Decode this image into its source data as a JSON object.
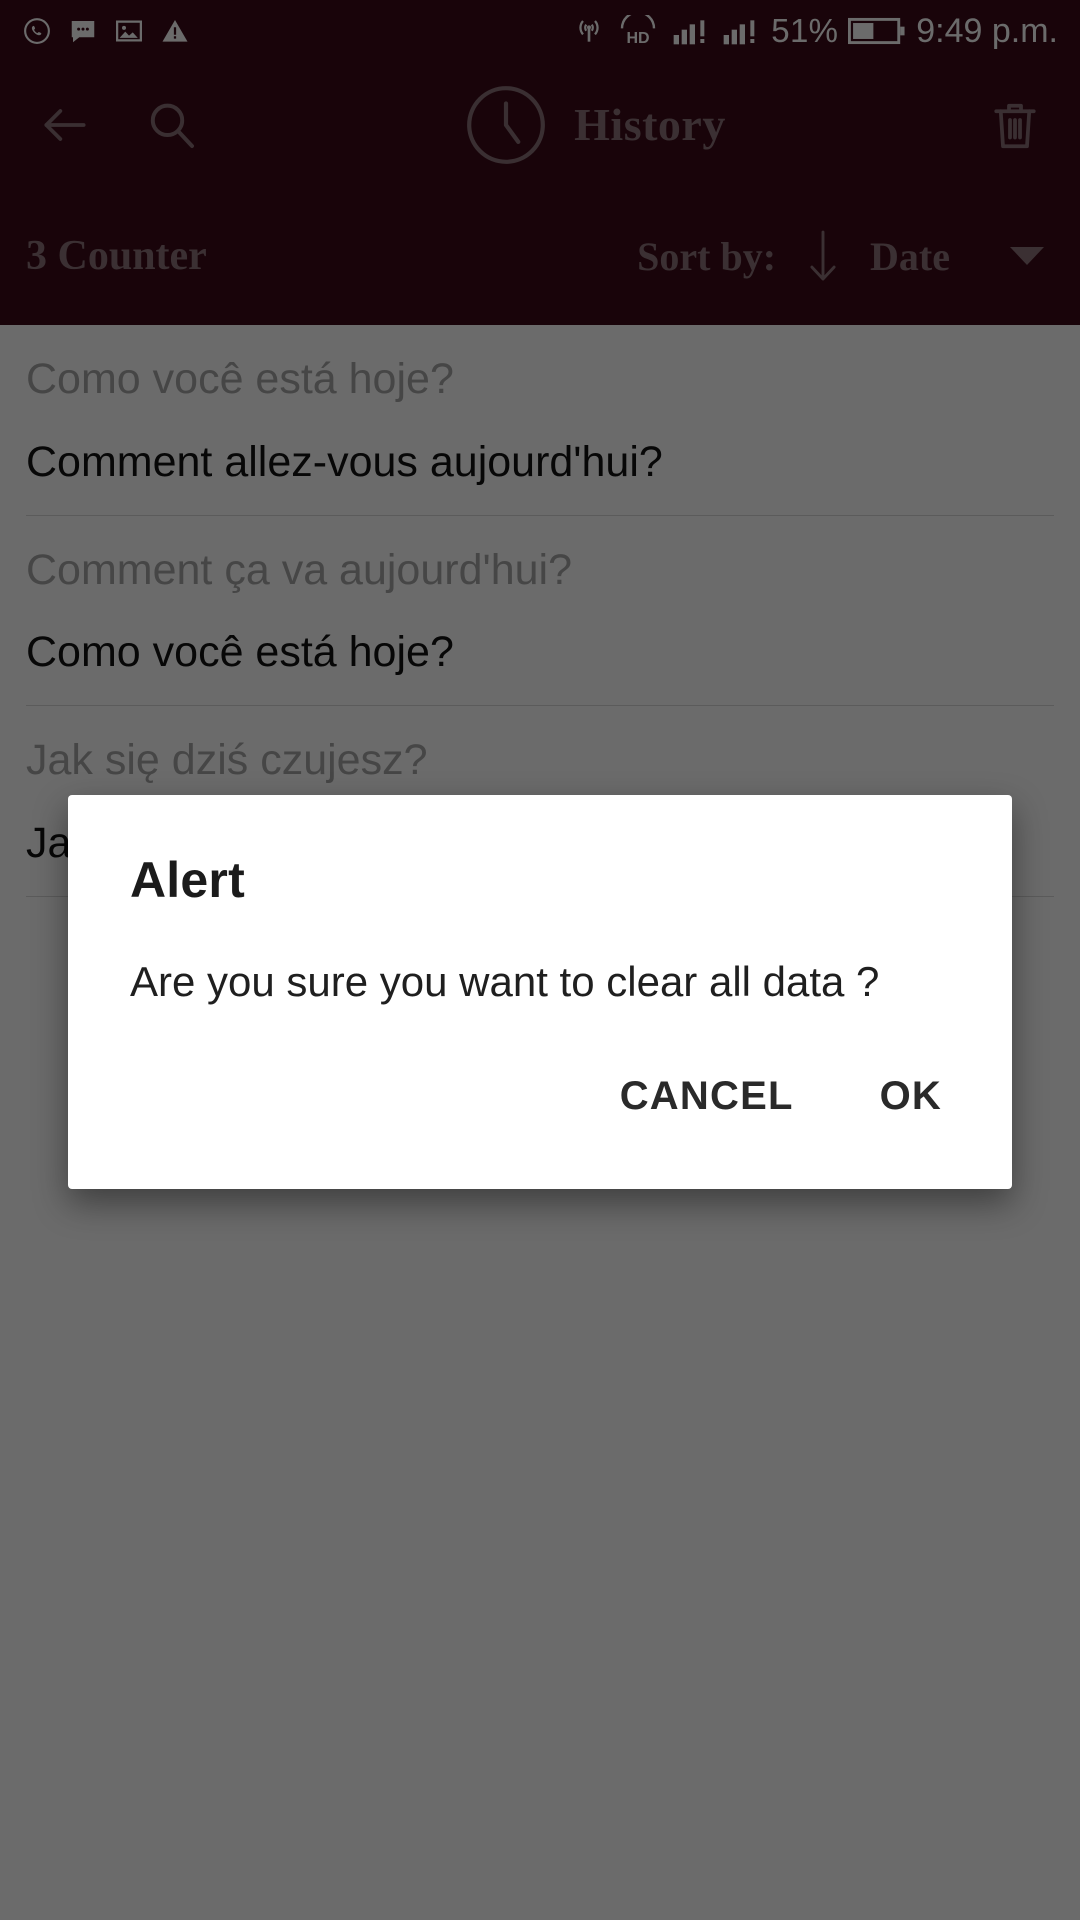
{
  "colors": {
    "app_bar_bg": "#3c0a18",
    "app_bar_fg": "#8d7379",
    "status_bar_bg": "#3c0a18",
    "list_source_text": "#a8a8a8",
    "list_target_text": "#111111",
    "dialog_bg": "#ffffff",
    "scrim": "rgba(0,0,0,0.58)"
  },
  "status_bar": {
    "left_icons": [
      {
        "name": "whatsapp-icon",
        "label": "WhatsApp"
      },
      {
        "name": "message-icon",
        "label": "Messages"
      },
      {
        "name": "image-icon",
        "label": "Screenshot"
      },
      {
        "name": "warning-icon",
        "label": "Warning"
      }
    ],
    "right_icons": [
      {
        "name": "hotspot-icon",
        "label": "Hotspot"
      },
      {
        "name": "hd-voice-icon",
        "label": "HD"
      },
      {
        "name": "signal-sim1-icon",
        "label": "Signal SIM 1"
      },
      {
        "name": "signal-sim2-icon",
        "label": "Signal SIM 2"
      },
      {
        "name": "battery-icon",
        "label": "Battery"
      }
    ],
    "battery_percent": "51%",
    "time": "9:49 p.m."
  },
  "app_bar": {
    "back_icon": "arrow-left-icon",
    "search_icon": "search-icon",
    "clock_icon": "clock-icon",
    "title": "History",
    "delete_icon": "trash-icon"
  },
  "sort_bar": {
    "counter_label": "3 Counter",
    "sort_by_label": "Sort by:",
    "sort_direction_icon": "arrow-down-icon",
    "sort_value": "Date",
    "dropdown_icon": "caret-down-icon"
  },
  "history": {
    "items": [
      {
        "source": "Como você está hoje?",
        "target": "Comment allez-vous aujourd'hui?"
      },
      {
        "source": "Comment ça va aujourd'hui?",
        "target": "Como você está hoje?"
      },
      {
        "source": "Jak się dziś czujesz?",
        "target": "Jak się dziś czujesz?"
      }
    ]
  },
  "dialog": {
    "title": "Alert",
    "message": "Are you sure you want to clear all data ?",
    "cancel_label": "CANCEL",
    "ok_label": "OK"
  }
}
